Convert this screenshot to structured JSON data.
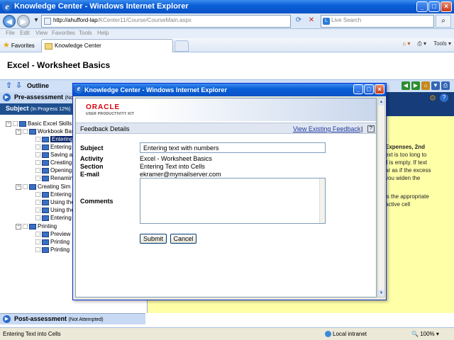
{
  "window": {
    "title": "Knowledge Center - Windows Internet Explorer"
  },
  "address": {
    "url_domain": "http://ahufford-lap",
    "url_rest": "/KCenter11/Course/CourseMain.aspx",
    "search_placeholder": "Live Search"
  },
  "menu": [
    "File",
    "Edit",
    "View",
    "Favorites",
    "Tools",
    "Help"
  ],
  "favbar": {
    "favorites_label": "Favorites",
    "tab_label": "Knowledge Center",
    "tools_label": "Tools"
  },
  "page": {
    "title": "Excel - Worksheet Basics",
    "outline_label": "Outline",
    "pre_assessment": "Pre-assessment",
    "pre_assessment_status": "(Not",
    "subject": "Subject",
    "subject_status": "(In Progress 12%)",
    "post_assessment": "Post-assessment",
    "post_assessment_status": "(Not Attempted)"
  },
  "tree": [
    {
      "label": "Basic Excel Skills"
    },
    {
      "label": "Workbook Basics"
    },
    {
      "label": "Entering"
    },
    {
      "label": "Entering"
    },
    {
      "label": "Saving a"
    },
    {
      "label": "Creating"
    },
    {
      "label": "Opening"
    },
    {
      "label": "Renaming"
    },
    {
      "label": "Creating Sim"
    },
    {
      "label": "Entering"
    },
    {
      "label": "Using the"
    },
    {
      "label": "Using the"
    },
    {
      "label": "Entering"
    },
    {
      "label": "Printing"
    },
    {
      "label": "Preview"
    },
    {
      "label": "Printing"
    },
    {
      "label": "Printing"
    }
  ],
  "help": {
    "heading": "Expenses, 2nd",
    "lines": [
      "ext is too long to",
      "ll is empty. If text",
      "ar as if the excess",
      "you widen the"
    ],
    "para2": [
      "is the appropriate",
      "active cell"
    ]
  },
  "status": {
    "text": "Entering Text into Cells",
    "zone": "Local intranet",
    "zoom": "100%"
  },
  "popup": {
    "title": "Knowledge Center - Windows Internet Explorer",
    "logo_main": "ORACLE",
    "logo_sub": "USER PRODUCTIVITY KIT",
    "section_title": "Feedback Details",
    "view_feedback": "View Existing Feedback",
    "separator": "|",
    "help_glyph": "?",
    "labels": {
      "subject": "Subject",
      "activity": "Activity",
      "section": "Section",
      "email": "E-mail",
      "comments": "Comments"
    },
    "values": {
      "subject": "Entering text with numbers",
      "activity": "Excel - Worksheet Basics",
      "section": "Entering Text into Cells",
      "email": "ekramer@mymailserver.com",
      "comments": ""
    },
    "submit": "Submit",
    "cancel": "Cancel"
  },
  "colors": {
    "title_blue": "#0a5fd8",
    "content_navy": "#163d79",
    "help_yellow": "#ffffa8",
    "oracle_red": "#d9000d"
  }
}
